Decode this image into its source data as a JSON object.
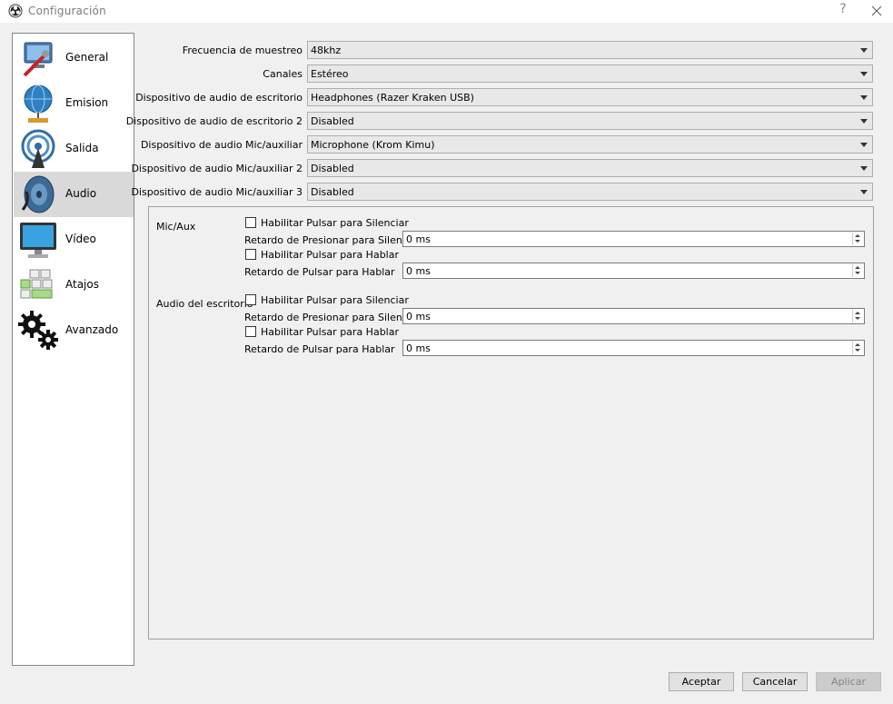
{
  "window": {
    "title": "Configuración",
    "help": "?"
  },
  "sidebar": {
    "items": [
      {
        "label": "General",
        "icon": "general-icon"
      },
      {
        "label": "Emision",
        "icon": "stream-globe-icon"
      },
      {
        "label": "Salida",
        "icon": "output-antenna-icon"
      },
      {
        "label": "Audio",
        "icon": "audio-speaker-icon",
        "selected": true
      },
      {
        "label": "Vídeo",
        "icon": "monitor-icon"
      },
      {
        "label": "Atajos",
        "icon": "keyboard-icon"
      },
      {
        "label": "Avanzado",
        "icon": "gears-icon"
      }
    ]
  },
  "audio": {
    "rows": [
      {
        "label": "Frecuencia de muestreo",
        "value": "48khz"
      },
      {
        "label": "Canales",
        "value": "Estéreo"
      },
      {
        "label": "Dispositivo de audio de escritorio",
        "value": "Headphones (Razer Kraken USB)"
      },
      {
        "label": "Dispositivo de audio de escritorio 2",
        "value": "Disabled"
      },
      {
        "label": "Dispositivo de audio Mic/auxiliar",
        "value": "Microphone (Krom Kimu)"
      },
      {
        "label": "Dispositivo de audio Mic/auxiliar 2",
        "value": "Disabled"
      },
      {
        "label": "Dispositivo de audio Mic/auxiliar 3",
        "value": "Disabled"
      }
    ],
    "groups": [
      {
        "name": "Mic/Aux",
        "ptm_check": "Habilitar Pulsar para Silenciar",
        "ptm_delay_label": "Retardo de Presionar para Silenciar",
        "ptm_delay_value": "0 ms",
        "ptt_check": "Habilitar Pulsar para Hablar",
        "ptt_delay_label": "Retardo de Pulsar para Hablar",
        "ptt_delay_value": "0 ms"
      },
      {
        "name": "Audio del escritorio",
        "ptm_check": "Habilitar Pulsar para Silenciar",
        "ptm_delay_label": "Retardo de Presionar para Silenciar",
        "ptm_delay_value": "0 ms",
        "ptt_check": "Habilitar Pulsar para Hablar",
        "ptt_delay_label": "Retardo de Pulsar para Hablar",
        "ptt_delay_value": "0 ms"
      }
    ]
  },
  "buttons": {
    "accept": "Aceptar",
    "cancel": "Cancelar",
    "apply": "Aplicar"
  }
}
